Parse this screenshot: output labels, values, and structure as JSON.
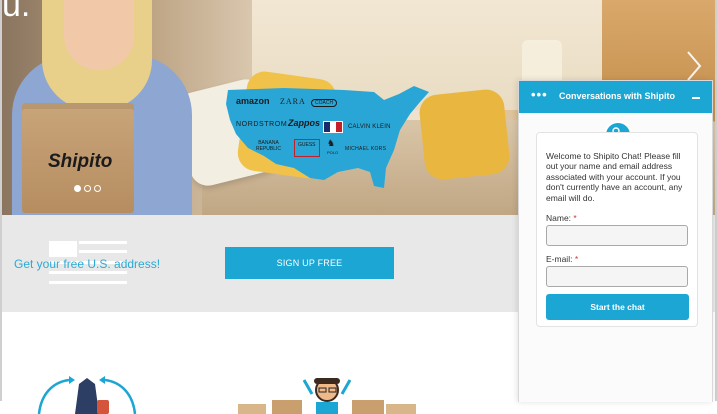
{
  "hero": {
    "partial_heading": "u.",
    "box_brand": "Shipito",
    "slides": 3,
    "active_slide": 1,
    "brands": {
      "amazon": "amazon",
      "zara": "ZARA",
      "coach": "COACH",
      "nordstrom": "NORDSTROM",
      "zappos": "Zappos",
      "calvin_klein": "CALVIN KLEIN",
      "banana_republic_1": "BANANA",
      "banana_republic_2": "REPUBLIC",
      "guess": "GUESS",
      "polo": "POLO",
      "michael_kors": "MICHAEL KORS"
    },
    "map_color": "#29a6d6"
  },
  "band": {
    "free_address_text": "Get your free U.S. address!",
    "signup_label": "SIGN UP FREE"
  },
  "chat": {
    "title": "Conversations with Shipito",
    "menu_icon": "more-dots-icon",
    "minimize_icon": "minimize-icon",
    "welcome": "Welcome to Shipito Chat! Please fill out your name and email address associated with your account. If you don't currently have an account, any email will do.",
    "name_label": "Name:",
    "email_label": "E-mail:",
    "required_mark": "*",
    "name_value": "",
    "email_value": "",
    "start_label": "Start the chat",
    "accent": "#1ba6d3"
  }
}
